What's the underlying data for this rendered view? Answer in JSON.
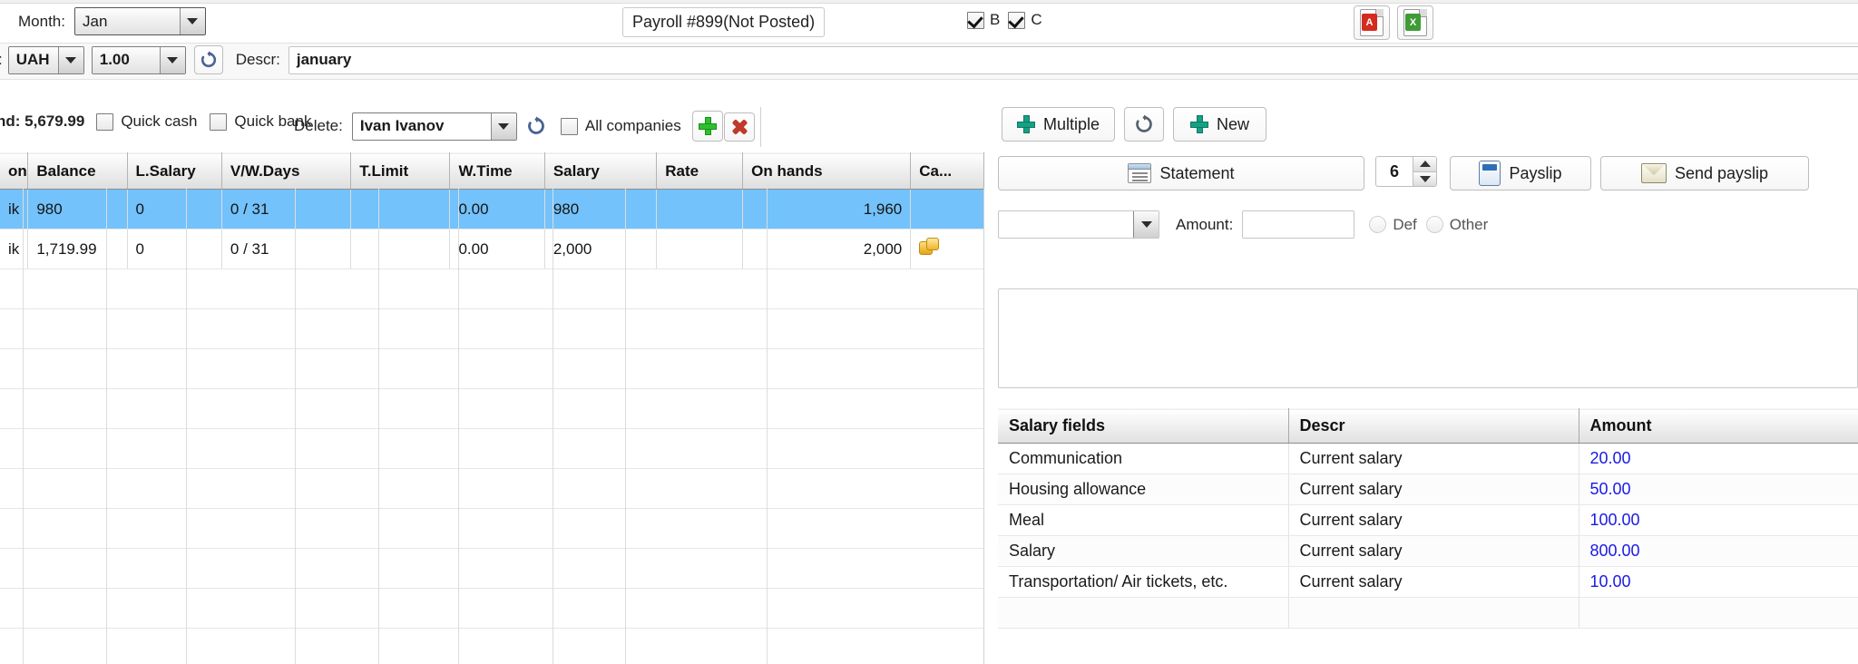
{
  "toolbar_row1": {
    "month_label": "Month:",
    "month_value": "Jan",
    "payroll_label": "Payroll #899(Not Posted)",
    "checkbox_b_label": "B",
    "checkbox_c_label": "C",
    "checkbox_b_checked": true,
    "checkbox_c_checked": true,
    "export_pdf_icon": "pdf-export-icon",
    "export_excel_icon": "excel-export-icon",
    "pdf_badge": "A",
    "xls_badge": "X"
  },
  "toolbar_row2": {
    "currency_prefix_label": ":",
    "currency_value": "UAH",
    "rate_value": "1.00",
    "refresh_icon": "refresh-icon",
    "descr_label": "Descr:",
    "descr_value": "january"
  },
  "toolbar_row3": {
    "fund_label": "nd: 5,679.99",
    "quick_cash_label": "Quick cash",
    "quick_cash_checked": false,
    "quick_bank_label": "Quick bank",
    "quick_bank_checked": false,
    "delete_label": "Delete:",
    "employee_value": "Ivan Ivanov",
    "refresh_icon": "refresh-icon",
    "all_companies_label": "All companies",
    "all_companies_checked": false,
    "add_icon": "add-plus-icon",
    "delete_icon": "delete-x-icon"
  },
  "grid": {
    "columns": [
      "on",
      "Balance",
      "L.Salary",
      "V/W.Days",
      "T.Limit",
      "W.Time",
      "Salary",
      "Rate",
      "On hands",
      "Ca..."
    ],
    "rows": [
      {
        "selected": true,
        "cells": [
          "ik",
          "980",
          "0",
          "0 / 31",
          "",
          "0.00",
          "980",
          "",
          "1,960",
          ""
        ],
        "has_coin_icon": false
      },
      {
        "selected": false,
        "cells": [
          "ik",
          "1,719.99",
          "0",
          "0 / 31",
          "",
          "0.00",
          "2,000",
          "",
          "2,000",
          ""
        ],
        "has_coin_icon": true
      }
    ],
    "empty_row_count": 12
  },
  "right_panel": {
    "multiple_label": "Multiple",
    "refresh_icon": "refresh-icon",
    "new_label": "New",
    "statement_label": "Statement",
    "copies_value": "6",
    "payslip_label": "Payslip",
    "send_payslip_label": "Send payslip",
    "type_select_value": "",
    "amount_label": "Amount:",
    "amount_value": "",
    "def_label": "Def",
    "other_label": "Other",
    "def_selected": false,
    "other_selected": false,
    "memo_value": ""
  },
  "salary_fields_table": {
    "columns": [
      "Salary fields",
      "Descr",
      "Amount"
    ],
    "rows": [
      {
        "field": "Communication",
        "descr": "Current salary",
        "amount": "20.00"
      },
      {
        "field": "Housing allowance",
        "descr": "Current salary",
        "amount": "50.00"
      },
      {
        "field": "Meal",
        "descr": "Current salary",
        "amount": "100.00"
      },
      {
        "field": "Salary",
        "descr": "Current salary",
        "amount": "800.00"
      },
      {
        "field": "Transportation/ Air tickets, etc.",
        "descr": "Current salary",
        "amount": "10.00"
      },
      {
        "field": "",
        "descr": "",
        "amount": ""
      }
    ]
  },
  "colors": {
    "selection_blue": "#73c2fb",
    "amount_blue": "#1a1ae6",
    "accent_teal": "#16a085",
    "accent_green": "#2fbf2f",
    "accent_red": "#c0392b"
  }
}
